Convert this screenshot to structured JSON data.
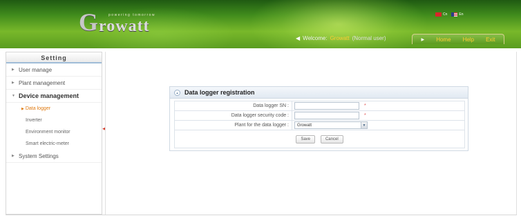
{
  "header": {
    "logo_initial": "G",
    "logo_rest": "rowatt",
    "logo_tagline": "powering tomorrow",
    "lang": [
      {
        "label": "Cn",
        "icon": "china-flag-icon"
      },
      {
        "label": "En",
        "icon": "uk-flag-icon"
      }
    ],
    "welcome_label": "Welcome:",
    "username": "Growatt",
    "role": "(Normal user)",
    "nav": {
      "home": "Home",
      "help": "Help",
      "exit": "Exit"
    }
  },
  "sidebar": {
    "title": "Setting",
    "items": [
      {
        "label": "User manage"
      },
      {
        "label": "Plant management"
      },
      {
        "label": "Device management",
        "expanded": true,
        "children": [
          {
            "label": "Data logger",
            "active": true
          },
          {
            "label": "Inverter"
          },
          {
            "label": "Environment monitor"
          },
          {
            "label": "Smart electric-meter"
          }
        ]
      },
      {
        "label": "System Settings"
      }
    ]
  },
  "panel": {
    "title": "Data logger registration",
    "fields": [
      {
        "label": "Data logger SN :",
        "value": "",
        "required_mark": "*"
      },
      {
        "label": "Data logger security code :",
        "value": "",
        "required_mark": "*"
      },
      {
        "label": "Plant for the data logger :",
        "selected": "Growatt"
      }
    ],
    "buttons": {
      "save": "Save",
      "cancel": "Cancel"
    }
  },
  "colors": {
    "header_green": "#5a9c20",
    "accent_orange": "#e07b12",
    "nav_yellow": "#ffcc33",
    "required_red": "#e05050"
  }
}
